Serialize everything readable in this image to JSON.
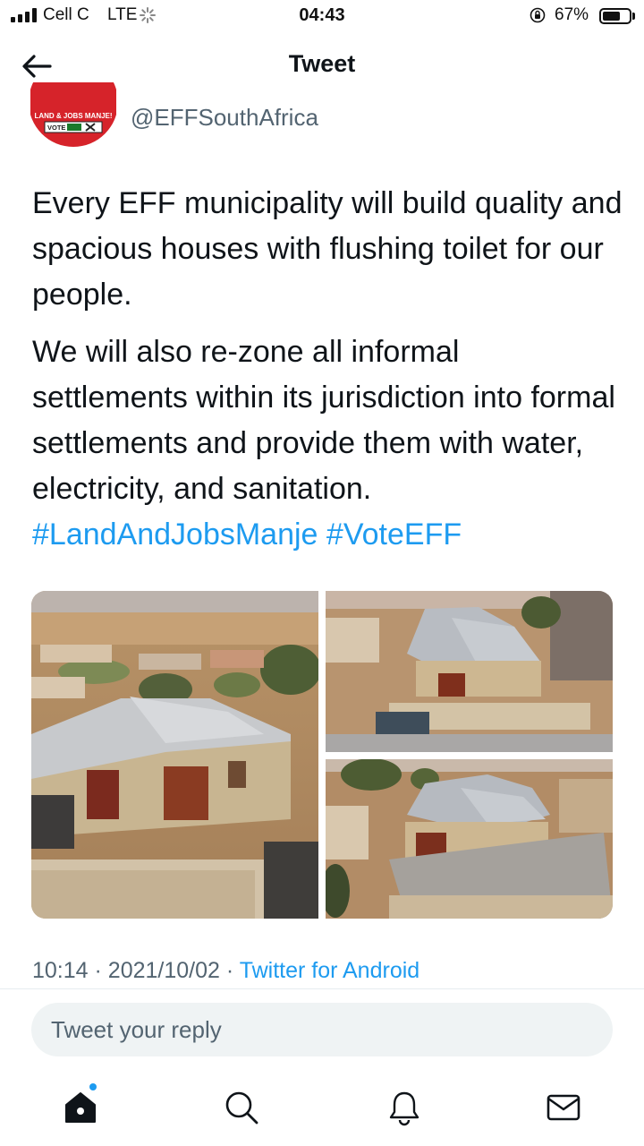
{
  "status_bar": {
    "carrier": "Cell C",
    "network": "LTE",
    "time": "04:43",
    "battery": "67%",
    "battery_level": 0.67
  },
  "header": {
    "title": "Tweet",
    "back_icon": "arrow-left-icon"
  },
  "tweet": {
    "handle": "@EFFSouthAfrica",
    "avatar_text": {
      "banner": "LAND & JOBS MANJE!",
      "vote": "VOTE"
    },
    "paragraph_1": "Every EFF municipality will build quality and spacious houses with flushing toilet for our people.",
    "paragraph_2": "We will also re-zone all informal settlements within its jurisdiction into formal settlements and provide them with water, electricity, and sanitation.",
    "hashtag_1": "#LandAndJobsManje",
    "hashtag_2": "#VoteEFF",
    "media_count": 3,
    "meta": {
      "time": "10:14",
      "separator": "·",
      "date": "2021/10/02",
      "source": "Twitter for Android"
    }
  },
  "reply": {
    "placeholder": "Tweet your reply"
  },
  "bottom_nav": {
    "items": [
      {
        "icon": "home-icon",
        "has_notification_dot": true
      },
      {
        "icon": "search-icon"
      },
      {
        "icon": "bell-icon"
      },
      {
        "icon": "mail-icon"
      }
    ]
  },
  "colors": {
    "accent": "#1d9bf0",
    "text_primary": "#0f1419",
    "text_secondary": "#536471",
    "avatar_red": "#d6232a"
  }
}
